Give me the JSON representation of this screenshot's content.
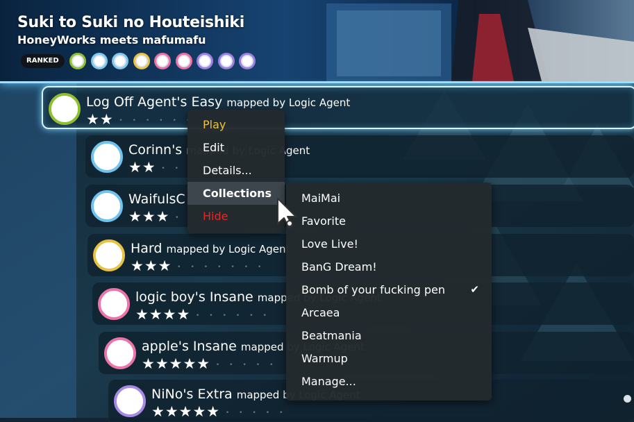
{
  "beatmap": {
    "title": "Suki to Suki no Houteishiki",
    "artist": "HoneyWorks meets mafumafu",
    "status": "RANKED",
    "difficulty_dots": [
      "#8fbf2c",
      "#7ec8ef",
      "#7ec8ef",
      "#e8c341",
      "#ec6fa6",
      "#ec6fa6",
      "#9d7fe0",
      "#9d7fe0",
      "#9d7fe0"
    ]
  },
  "difficulties": [
    {
      "name": "Log Off Agent's Easy",
      "mapper": "mapped by Logic Agent",
      "stars_filled": "★★",
      "stars_empty": "•••••••••",
      "ring_color": "#8fbf2c",
      "selected": true
    },
    {
      "name": "Corinn's",
      "mapper": "mapped by Logic Agent",
      "stars_filled": "★★",
      "stars_empty": "••••••••",
      "ring_color": "#6fc3ee",
      "selected": false
    },
    {
      "name": "WaifulsC",
      "mapper": "",
      "stars_filled": "★★★",
      "stars_empty": "•••••••",
      "ring_color": "#6fc3ee",
      "selected": false
    },
    {
      "name": "Hard",
      "mapper": "mapped by Logic Agent",
      "stars_filled": "★★★",
      "stars_empty": "•••••••",
      "ring_color": "#e8c341",
      "selected": false
    },
    {
      "name": "logic boy's Insane",
      "mapper": "mapped by Logic Agent",
      "stars_filled": "★★★★",
      "stars_empty": "••••••",
      "ring_color": "#ee73a8",
      "selected": false
    },
    {
      "name": "apple's Insane",
      "mapper": "mapped by Logic Agent",
      "stars_filled": "★★★★★",
      "stars_empty": "•••••",
      "ring_color": "#ee73a8",
      "selected": false
    },
    {
      "name": "NiNo's Extra",
      "mapper": "mapped by Logic Agent",
      "stars_filled": "★★★★★",
      "stars_empty": "•••••",
      "ring_color": "#a58ae6",
      "selected": false
    }
  ],
  "context_menu": {
    "play": "Play",
    "edit": "Edit",
    "details": "Details...",
    "collections": "Collections",
    "hide": "Hide",
    "play_color": "#f2c52c",
    "hide_color": "#e02a2a"
  },
  "collections_menu": {
    "items": [
      "MaiMai",
      "Favorite",
      "Love Live!",
      "BanG Dream!",
      "Bomb of your fucking pen",
      "Arcaea",
      "Beatmania",
      "Warmup",
      "Manage..."
    ],
    "checked": "Bomb of your fucking pen",
    "check_mark": "✔"
  }
}
